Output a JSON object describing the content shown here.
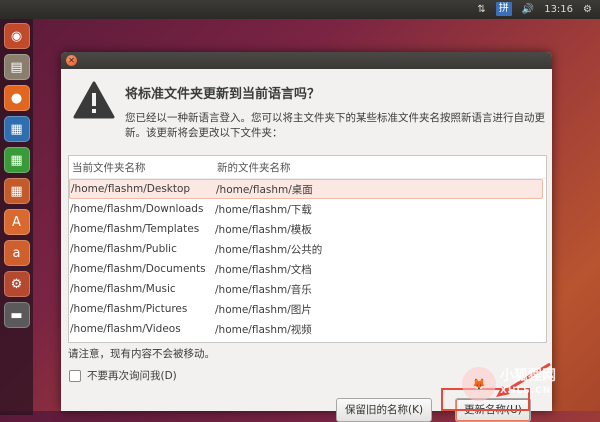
{
  "top_panel": {
    "ime_label": "拼",
    "clock": "13:16"
  },
  "launcher": {
    "items": [
      "dash-icon",
      "files-icon",
      "firefox-icon",
      "writer-icon",
      "calc-icon",
      "impress-icon",
      "software-center-icon",
      "amazon-icon",
      "settings-icon",
      "drive-icon"
    ]
  },
  "dialog": {
    "close_glyph": "✕",
    "heading": "将标准文件夹更新到当前语言吗？",
    "description": "您已经以一种新语言登入。您可以将主文件夹下的某些标准文件夹名按照新语言进行自动更新。该更新将会更改以下文件夹：",
    "columns": {
      "current": "当前文件夹名称",
      "new": "新的文件夹名称"
    },
    "rows": [
      {
        "current": "/home/flashm/Desktop",
        "new": "/home/flashm/桌面"
      },
      {
        "current": "/home/flashm/Downloads",
        "new": "/home/flashm/下载"
      },
      {
        "current": "/home/flashm/Templates",
        "new": "/home/flashm/模板"
      },
      {
        "current": "/home/flashm/Public",
        "new": "/home/flashm/公共的"
      },
      {
        "current": "/home/flashm/Documents",
        "new": "/home/flashm/文档"
      },
      {
        "current": "/home/flashm/Music",
        "new": "/home/flashm/音乐"
      },
      {
        "current": "/home/flashm/Pictures",
        "new": "/home/flashm/图片"
      },
      {
        "current": "/home/flashm/Videos",
        "new": "/home/flashm/视频"
      }
    ],
    "note": "请注意，现有内容不会被移动。",
    "dont_ask_label": "不要再次询问我(D)",
    "keep_button": "保留旧的名称(K)",
    "update_button": "更新名称(U)"
  },
  "watermark": {
    "name": "小狐狸网",
    "url": "XHLS.CN"
  },
  "colors": {
    "annotation": "#e64a3c",
    "accent": "#e0531f"
  }
}
